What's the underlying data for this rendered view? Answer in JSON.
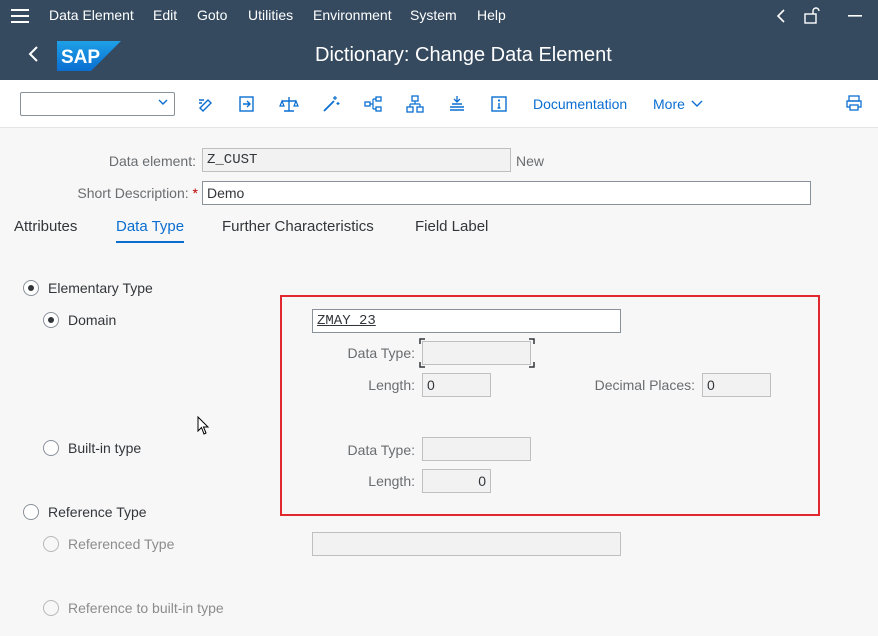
{
  "menu": {
    "items": [
      "Data Element",
      "Edit",
      "Goto",
      "Utilities",
      "Environment",
      "System",
      "Help"
    ]
  },
  "title": "Dictionary: Change Data Element",
  "logo_text": "SAP",
  "toolbar": {
    "documentation_label": "Documentation",
    "more_label": "More"
  },
  "header": {
    "data_element_label": "Data element:",
    "data_element_value": "Z_CUST",
    "status": "New",
    "short_desc_label": "Short Description:",
    "required_marker": "*",
    "short_desc_value": "Demo"
  },
  "tabs": [
    {
      "label": "Attributes",
      "active": false
    },
    {
      "label": "Data Type",
      "active": true
    },
    {
      "label": "Further Characteristics",
      "active": false
    },
    {
      "label": "Field Label",
      "active": false
    }
  ],
  "data_type": {
    "elementary_type_label": "Elementary Type",
    "domain_label": "Domain",
    "domain_value": "ZMAY_23",
    "data_type_label": "Data Type:",
    "data_type_value": "",
    "length_label": "Length:",
    "length_value": "0",
    "decimal_places_label": "Decimal Places:",
    "decimal_places_value": "0",
    "builtin_label": "Built-in type",
    "builtin_data_type_label": "Data Type:",
    "builtin_data_type_value": "",
    "builtin_length_label": "Length:",
    "builtin_length_value": "0",
    "reference_type_label": "Reference Type",
    "referenced_type_label": "Referenced Type",
    "referenced_type_value": "",
    "reference_builtin_label": "Reference to built-in type"
  },
  "colors": {
    "shell": "#354a5f",
    "accent": "#0a6ed1",
    "highlight_box": "#e0282e"
  }
}
